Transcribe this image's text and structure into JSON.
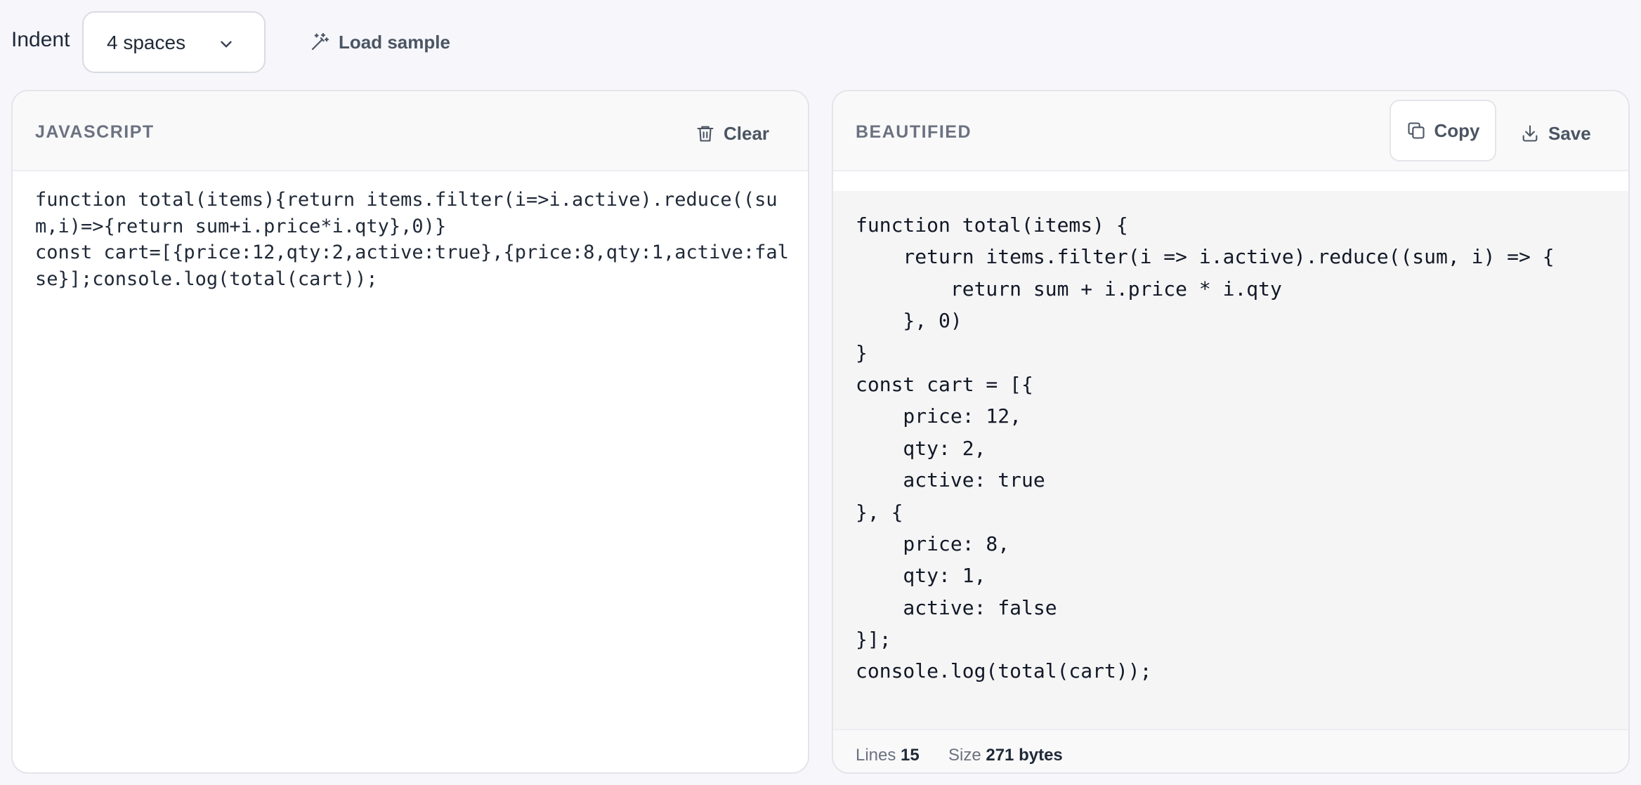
{
  "toolbar": {
    "indent_label": "Indent",
    "indent_value": "4 spaces",
    "load_sample_label": "Load sample"
  },
  "input_panel": {
    "title": "JAVASCRIPT",
    "clear_label": "Clear",
    "code": "function total(items){return items.filter(i=>i.active).reduce((sum,i)=>{return sum+i.price*i.qty},0)}\nconst cart=[{price:12,qty:2,active:true},{price:8,qty:1,active:false}];console.log(total(cart));"
  },
  "output_panel": {
    "title": "BEAUTIFIED",
    "copy_label": "Copy",
    "save_label": "Save",
    "lines": [
      "function total(items) {",
      "    return items.filter(i => i.active).reduce((sum, i) => {",
      "        return sum + i.price * i.qty",
      "    }, 0)",
      "}",
      "const cart = [{",
      "    price: 12,",
      "    qty: 2,",
      "    active: true",
      "}, {",
      "    price: 8,",
      "    qty: 1,",
      "    active: false",
      "}];",
      "console.log(total(cart));"
    ]
  },
  "status": {
    "lines_label": "Lines",
    "lines_value": "15",
    "size_label": "Size",
    "size_value": "271 bytes"
  },
  "icons": {
    "chevron": "chevron-down-icon",
    "wand": "magic-wand-icon",
    "trash": "trash-icon",
    "copy": "copy-icon",
    "download": "download-icon"
  },
  "colors": {
    "background": "#f6f6fb",
    "panel": "#ffffff",
    "header": "#f9f9fa",
    "output_bg": "#f5f5f5",
    "muted_text": "#6b7280"
  }
}
